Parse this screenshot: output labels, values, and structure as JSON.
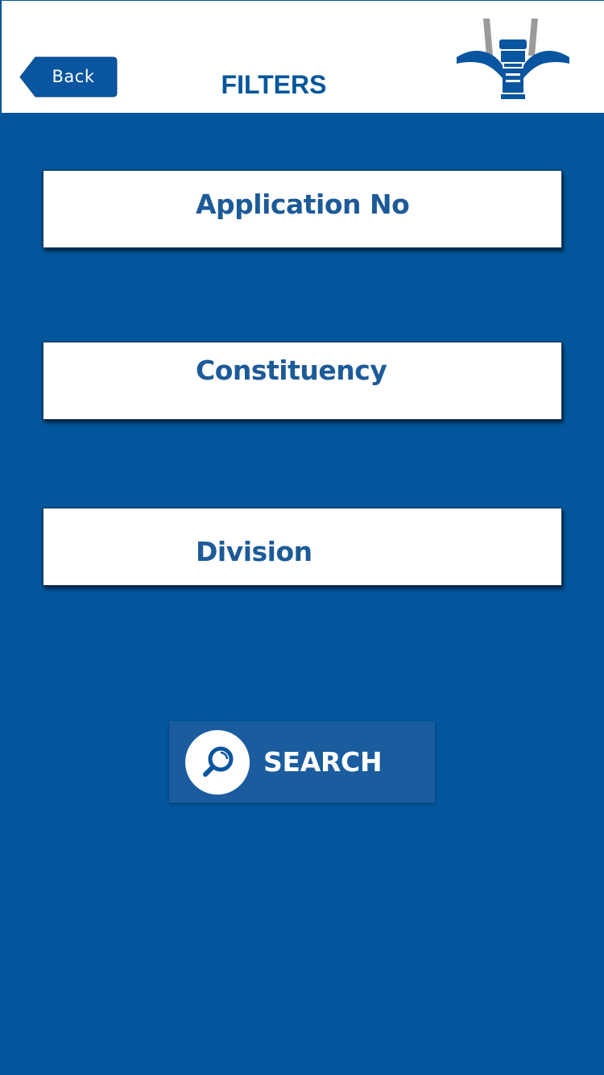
{
  "header": {
    "back_label": "Back",
    "title": "FILTERS"
  },
  "filters": [
    {
      "label": "Application No"
    },
    {
      "label": "Constituency"
    },
    {
      "label": "Division"
    }
  ],
  "search": {
    "label": "SEARCH",
    "icon": "search-icon"
  },
  "colors": {
    "background": "#02569b",
    "header_bg": "#ffffff",
    "title_text": "#02569b",
    "card_text": "#1d5a98",
    "search_button": "#1a5c9e",
    "logo_gray": "#9a9a9a"
  }
}
